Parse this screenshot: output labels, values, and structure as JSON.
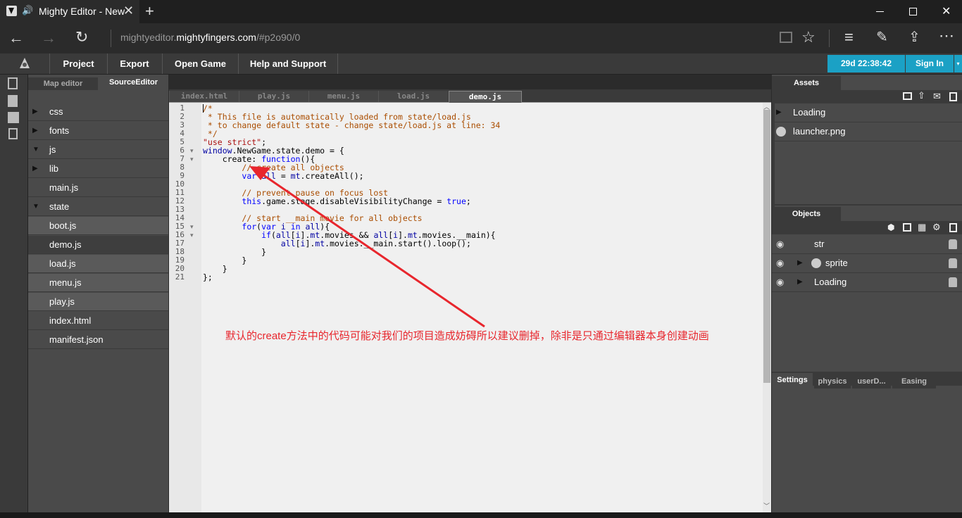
{
  "browser": {
    "tab_title": "Mighty Editor - New",
    "url_host": "mightyeditor.",
    "url_domain": "mightyfingers.com",
    "url_path": "/#p2o90/0",
    "icons": [
      "back-icon",
      "forward-icon",
      "refresh-icon",
      "reading-view-icon",
      "favorite-star-icon",
      "hub-icon",
      "web-note-icon",
      "share-icon",
      "more-icon"
    ]
  },
  "app_menu": {
    "items": [
      "Project",
      "Export",
      "Open Game",
      "Help and Support"
    ],
    "timer": "29d 22:38:42",
    "sign_in": "Sign In"
  },
  "left_tabs": {
    "map_editor": "Map editor",
    "source_editor": "SourceEditor"
  },
  "file_tree": [
    {
      "label": "css",
      "type": "folder",
      "expanded": false
    },
    {
      "label": "fonts",
      "type": "folder",
      "expanded": false
    },
    {
      "label": "js",
      "type": "folder",
      "expanded": true
    },
    {
      "label": "lib",
      "type": "folder",
      "expanded": false
    },
    {
      "label": "main.js",
      "type": "file"
    },
    {
      "label": "state",
      "type": "folder",
      "expanded": true
    },
    {
      "label": "boot.js",
      "type": "file"
    },
    {
      "label": "demo.js",
      "type": "file",
      "selected": true
    },
    {
      "label": "load.js",
      "type": "file"
    },
    {
      "label": "menu.js",
      "type": "file"
    },
    {
      "label": "play.js",
      "type": "file"
    },
    {
      "label": "index.html",
      "type": "file"
    },
    {
      "label": "manifest.json",
      "type": "file"
    }
  ],
  "editor_tabs": [
    "index.html",
    "play.js",
    "menu.js",
    "load.js",
    "demo.js"
  ],
  "active_editor_tab": "demo.js",
  "line_numbers": [
    "1",
    "2",
    "3",
    "4",
    "5",
    "6",
    "7",
    "8",
    "9",
    "10",
    "11",
    "12",
    "13",
    "14",
    "15",
    "16",
    "17",
    "18",
    "19",
    "20",
    "21"
  ],
  "code_lines": [
    "/*",
    " * This file is automatically loaded from state/load.js",
    " * to change default state - change state/load.js at line: 34",
    " */",
    "\"use strict\";",
    "window.NewGame.state.demo = {",
    "    create: function(){",
    "        // create all objects",
    "        var all = mt.createAll();",
    "",
    "        // prevent pause on focus lost",
    "        this.game.stage.disableVisibilityChange = true;",
    "",
    "        // start __main movie for all objects",
    "        for(var i in all){",
    "            if(all[i].mt.movies && all[i].mt.movies.__main){",
    "                all[i].mt.movies.__main.start().loop();",
    "            }",
    "        }",
    "    }",
    "};"
  ],
  "assets": {
    "title": "Assets",
    "items": [
      {
        "label": "Loading",
        "type": "folder"
      },
      {
        "label": "launcher.png",
        "type": "image"
      }
    ]
  },
  "objects": {
    "title": "Objects",
    "items": [
      {
        "label": "str"
      },
      {
        "label": "sprite"
      },
      {
        "label": "Loading"
      }
    ]
  },
  "settings_tabs": [
    "Settings",
    "physics",
    "userD...",
    "Easing"
  ],
  "annotation": "默认的create方法中的代码可能对我们的项目造成妨碍所以建议删掉，除非是只通过编辑器本身创建动画",
  "colors": {
    "annotation": "#e8262d",
    "timer_bg": "#1ba1c5"
  }
}
